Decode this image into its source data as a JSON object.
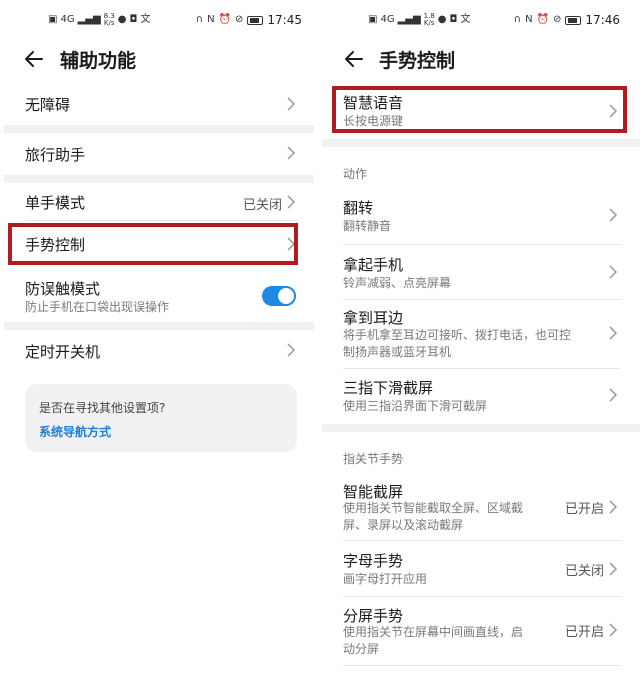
{
  "left": {
    "status": {
      "signal": "4G",
      "speed_value": "8.3",
      "speed_unit": "K/s",
      "time": "17:45",
      "battery": "65"
    },
    "title": "辅助功能",
    "items": [
      {
        "label": "无障碍"
      },
      {
        "label": "旅行助手"
      },
      {
        "label": "单手模式",
        "value": "已关闭"
      },
      {
        "label": "手势控制"
      },
      {
        "label": "防误触模式",
        "subtitle": "防止手机在口袋出现误操作",
        "toggle": "on"
      },
      {
        "label": "定时开关机"
      }
    ],
    "suggestion": {
      "question": "是否在寻找其他设置项?",
      "link": "系统导航方式"
    }
  },
  "right": {
    "status": {
      "signal": "4G",
      "speed_value": "1.8",
      "speed_unit": "K/s",
      "time": "17:46",
      "battery": "65"
    },
    "title": "手势控制",
    "top_item": {
      "label": "智慧语音",
      "subtitle": "长按电源键"
    },
    "section_actions": {
      "label": "动作",
      "items": [
        {
          "label": "翻转",
          "subtitle": "翻转静音"
        },
        {
          "label": "拿起手机",
          "subtitle": "铃声减弱、点亮屏幕"
        },
        {
          "label": "拿到耳边",
          "subtitle_line1": "将手机拿至耳边可接听、拨打电话，也可控",
          "subtitle_line2": "制扬声器或蓝牙耳机"
        },
        {
          "label": "三指下滑截屏",
          "subtitle": "使用三指沿界面下滑可截屏"
        }
      ]
    },
    "section_knuckle": {
      "label": "指关节手势",
      "items": [
        {
          "label": "智能截屏",
          "subtitle_line1": "使用指关节智能截取全屏、区域截",
          "subtitle_line2": "屏、录屏以及滚动截屏",
          "value": "已开启"
        },
        {
          "label": "字母手势",
          "subtitle": "画字母打开应用",
          "value": "已关闭"
        },
        {
          "label": "分屏手势",
          "subtitle_line1": "使用指关节在屏幕中间画直线，启",
          "subtitle_line2": "动分屏",
          "value": "已开启"
        }
      ]
    }
  },
  "colors": {
    "highlight": "#b01c20",
    "accent": "#1e88e5",
    "link": "#1e7fd8"
  }
}
